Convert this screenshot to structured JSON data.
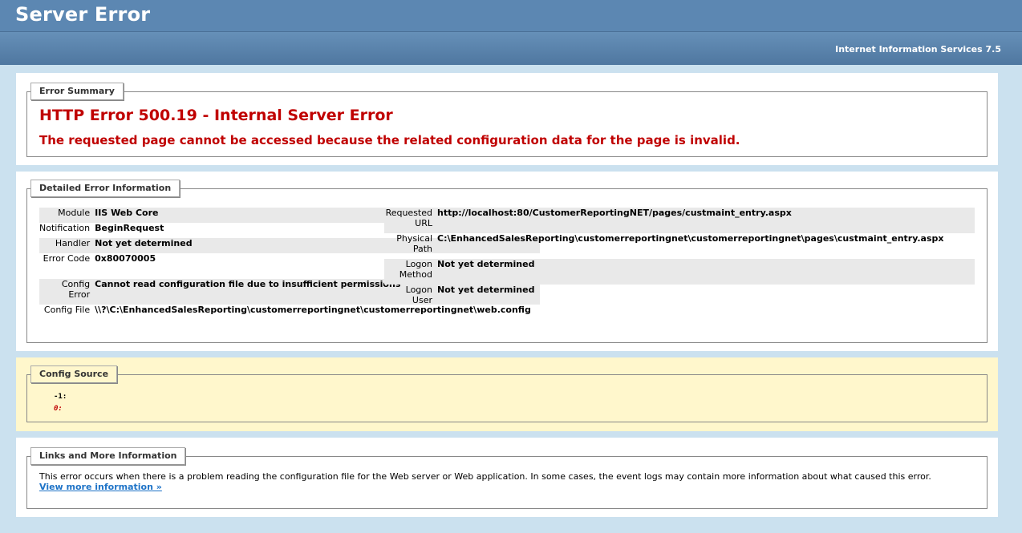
{
  "header": {
    "title": "Server Error",
    "product": "Internet Information Services 7.5"
  },
  "summary": {
    "legend": "Error Summary",
    "title": "HTTP Error 500.19 - Internal Server Error",
    "message": "The requested page cannot be accessed because the related configuration data for the page is invalid."
  },
  "details": {
    "legend": "Detailed Error Information",
    "left": [
      {
        "label": "Module",
        "value": "IIS Web Core"
      },
      {
        "label": "Notification",
        "value": "BeginRequest"
      },
      {
        "label": "Handler",
        "value": "Not yet determined"
      },
      {
        "label": "Error Code",
        "value": "0x80070005"
      },
      {
        "label": "Config Error",
        "value": "Cannot read configuration file due to insufficient permissions"
      },
      {
        "label": "Config File",
        "value": "\\\\?\\C:\\EnhancedSalesReporting\\customerreportingnet\\customerreportingnet\\web.config"
      }
    ],
    "right": [
      {
        "label": "Requested URL",
        "value": "http://localhost:80/CustomerReportingNET/pages/custmaint_entry.aspx"
      },
      {
        "label": "Physical Path",
        "value": "C:\\EnhancedSalesReporting\\customerreportingnet\\customerreportingnet\\pages\\custmaint_entry.aspx"
      },
      {
        "label": "Logon Method",
        "value": "Not yet determined"
      },
      {
        "label": "Logon User",
        "value": "Not yet determined"
      }
    ]
  },
  "config_source": {
    "legend": "Config Source",
    "line1": "-1:",
    "line2": "0:"
  },
  "links": {
    "legend": "Links and More Information",
    "text": "This error occurs when there is a problem reading the configuration file for the Web server or Web application. In some cases, the event logs may contain more information about what caused this error.",
    "link_label": "View more information »"
  }
}
